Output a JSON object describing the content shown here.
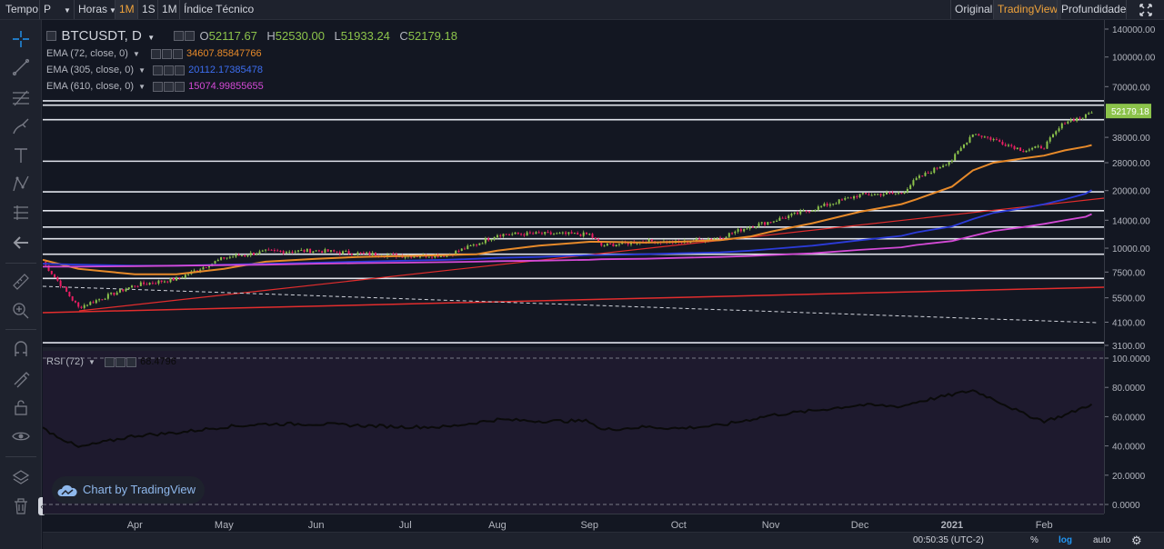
{
  "toolbar": {
    "tempo": "Tempo",
    "symbol_field": "P",
    "interval_menu": "Horas",
    "interval_1m_min": "1M",
    "interval_1s": "1S",
    "interval_1m_month": "1M",
    "indicators": "Índice Técnico",
    "view_original": "Original",
    "view_tradingview": "TradingView",
    "view_depth": "Profundidade"
  },
  "legend": {
    "symbol": "BTCUSDT, D",
    "open_label": "O",
    "open": "52117.67",
    "high_label": "H",
    "high": "52530.00",
    "low_label": "L",
    "low": "51933.24",
    "close_label": "C",
    "close": "52179.18",
    "ema1_name": "EMA (72, close, 0)",
    "ema1_value": "34607.85847766",
    "ema2_name": "EMA (305, close, 0)",
    "ema2_value": "20112.17385478",
    "ema3_name": "EMA (610, close, 0)",
    "ema3_value": "15074.99855655",
    "rsi_name": "RSI (72)",
    "rsi_value": "68.4796"
  },
  "watermark": "Chart by TradingView",
  "bottombar": {
    "clock": "00:50:35 (UTC-2)",
    "percent": "%",
    "log": "log",
    "auto": "auto"
  },
  "colors": {
    "up": "#8cc34b",
    "down": "#e91e63",
    "ema72": "#e78a2a",
    "ema305": "#2b3bd9",
    "ema610": "#d44ad6",
    "trend_red": "#e32d2d",
    "hline": "#e0e3eb",
    "rsi_line": "#0a0a0a",
    "last_price_bg": "#8cc34b"
  },
  "chart_data": [
    {
      "type": "candlestick",
      "title": "BTCUSDT, D",
      "scale": "log",
      "ylim": [
        3100,
        140000
      ],
      "price_ticks": [
        140000,
        100000,
        70000,
        52179.18,
        38000,
        28000,
        20000,
        14000,
        10000,
        7500,
        5500,
        4100,
        3100
      ],
      "price_tick_labels": [
        "140000.00",
        "100000.00",
        "70000.00",
        "52179.18",
        "38000.00",
        "28000.00",
        "20000.00",
        "14000.00",
        "10000.00",
        "7500.00",
        "5500.00",
        "4100.00",
        "3100.00"
      ],
      "last_price": 52179.18,
      "x_ticks": [
        "Apr",
        "May",
        "Jun",
        "Jul",
        "Aug",
        "Sep",
        "Oct",
        "Nov",
        "Dec",
        "2021",
        "Feb"
      ],
      "x": [
        "2020-03-01",
        "2020-03-13",
        "2020-04-01",
        "2020-04-15",
        "2020-05-01",
        "2020-05-15",
        "2020-06-01",
        "2020-06-15",
        "2020-07-01",
        "2020-07-15",
        "2020-07-25",
        "2020-08-01",
        "2020-08-15",
        "2020-09-01",
        "2020-09-05",
        "2020-09-20",
        "2020-10-01",
        "2020-10-15",
        "2020-10-25",
        "2020-11-01",
        "2020-11-15",
        "2020-12-01",
        "2020-12-15",
        "2020-12-20",
        "2021-01-01",
        "2021-01-08",
        "2021-01-15",
        "2021-01-25",
        "2021-02-01",
        "2021-02-08",
        "2021-02-15",
        "2021-02-17"
      ],
      "close": [
        8500,
        4900,
        6400,
        6900,
        8900,
        9600,
        9700,
        9400,
        9100,
        9200,
        10500,
        11800,
        11900,
        11800,
        10300,
        10900,
        10700,
        11400,
        13000,
        13800,
        16000,
        19000,
        19400,
        23000,
        29000,
        40000,
        37000,
        32500,
        34000,
        46000,
        49000,
        52179
      ],
      "series": [
        {
          "name": "EMA (72, close, 0)",
          "values": [
            8700,
            7800,
            7300,
            7300,
            7800,
            8500,
            8800,
            9000,
            9100,
            9200,
            9300,
            9700,
            10300,
            10800,
            10800,
            10700,
            10800,
            11000,
            11500,
            12200,
            13500,
            15500,
            17000,
            18000,
            21000,
            25500,
            28000,
            29500,
            30500,
            32500,
            34000,
            34608
          ]
        },
        {
          "name": "EMA (305, close, 0)",
          "values": [
            8300,
            8200,
            8100,
            8100,
            8200,
            8300,
            8400,
            8500,
            8600,
            8700,
            8800,
            8900,
            9000,
            9200,
            9200,
            9300,
            9400,
            9500,
            9700,
            9900,
            10300,
            11000,
            11600,
            12100,
            13000,
            14200,
            15300,
            16200,
            17000,
            18000,
            19300,
            20112
          ]
        },
        {
          "name": "EMA (610, close, 0)",
          "values": [
            8000,
            8000,
            8050,
            8100,
            8150,
            8200,
            8300,
            8350,
            8400,
            8450,
            8500,
            8550,
            8600,
            8700,
            8750,
            8800,
            8900,
            9000,
            9100,
            9200,
            9400,
            9800,
            10100,
            10400,
            10900,
            11600,
            12300,
            12900,
            13400,
            14000,
            14600,
            15075
          ]
        }
      ],
      "horizontal_levels": [
        59000,
        56000,
        47000,
        28500,
        19700,
        15700,
        12900,
        11200,
        9300,
        6950,
        3200
      ]
    },
    {
      "type": "line",
      "title": "RSI (72)",
      "ylim": [
        0,
        100
      ],
      "ticks": [
        0,
        20,
        40,
        60,
        80,
        100
      ],
      "tick_labels": [
        "0.0000",
        "20.0000",
        "40.0000",
        "60.0000",
        "80.0000",
        "100.0000"
      ],
      "x": [
        "2020-03-01",
        "2020-03-13",
        "2020-04-01",
        "2020-04-15",
        "2020-05-01",
        "2020-05-15",
        "2020-06-01",
        "2020-06-15",
        "2020-07-01",
        "2020-07-15",
        "2020-07-25",
        "2020-08-01",
        "2020-08-15",
        "2020-09-01",
        "2020-09-05",
        "2020-09-20",
        "2020-10-01",
        "2020-10-15",
        "2020-10-25",
        "2020-11-01",
        "2020-11-15",
        "2020-12-01",
        "2020-12-15",
        "2020-12-20",
        "2021-01-01",
        "2021-01-08",
        "2021-01-15",
        "2021-01-25",
        "2021-02-01",
        "2021-02-08",
        "2021-02-15",
        "2021-02-17"
      ],
      "values": [
        52,
        39,
        47,
        49,
        53,
        55,
        55,
        54,
        53,
        53,
        56,
        58,
        57,
        57,
        51,
        53,
        52,
        54,
        58,
        61,
        64,
        68,
        67,
        70,
        75,
        78,
        72,
        62,
        57,
        61,
        67,
        68.4796
      ]
    }
  ]
}
